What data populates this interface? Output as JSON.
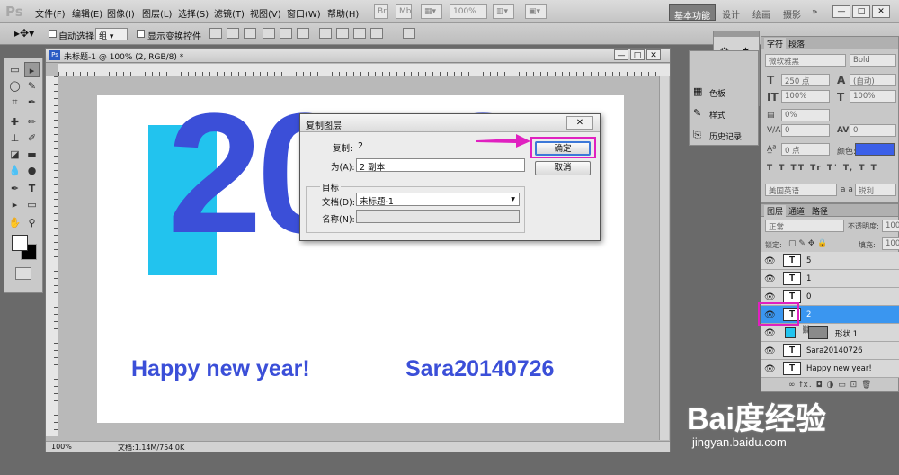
{
  "app": {
    "logo": "Ps"
  },
  "menu": [
    "文件(F)",
    "编辑(E)",
    "图像(I)",
    "图层(L)",
    "选择(S)",
    "滤镜(T)",
    "视图(V)",
    "窗口(W)",
    "帮助(H)"
  ],
  "menubar": {
    "zoom": "100%",
    "workspaces": [
      "基本功能",
      "设计",
      "绘画",
      "摄影"
    ],
    "more": "»",
    "window_buttons": [
      "—",
      "□",
      "✕"
    ]
  },
  "options": {
    "auto_select_label": "自动选择:",
    "auto_select_value": "组",
    "show_transform_label": "显示变换控件"
  },
  "document": {
    "tab_title": "未标题-1 @ 100% (2, RGB/8) *",
    "canvas_big_number": "2013",
    "canvas_text_left": "Happy new year!",
    "canvas_text_right": "Sara20140726",
    "zoom": "100%",
    "doc_size": "文档:1.14M/754.0K"
  },
  "dialog": {
    "title": "复制图层",
    "copy_label": "复制:",
    "copy_value": "2",
    "as_label": "为(A):",
    "as_value": "2 副本",
    "dest_group": "目标",
    "doc_label": "文档(D):",
    "doc_value": "未标题-1",
    "name_label": "名称(N):",
    "name_value": "",
    "ok": "确定",
    "cancel": "取消"
  },
  "dock": {
    "items": [
      "色板",
      "样式",
      "历史记录"
    ]
  },
  "character": {
    "tabs": [
      "字符",
      "段落"
    ],
    "font_family": "微软雅黑",
    "font_style": "Bold",
    "size": "250 点",
    "leading": "(自动)",
    "vscale": "100%",
    "hscale": "100%",
    "tracking_pct": "0%",
    "kerning": "0",
    "tracking": "0",
    "baseline": "0 点",
    "color_label": "颜色:",
    "color": "#3b5fe8",
    "style_buttons": [
      "T",
      "T",
      "TT",
      "Tr",
      "T'",
      "T,",
      "T",
      "T"
    ],
    "language": "美国英语",
    "aa_label": "a a",
    "aa_value": "锐利"
  },
  "layers": {
    "tabs": [
      "图层",
      "通道",
      "路径"
    ],
    "blend": "正常",
    "opacity_label": "不透明度:",
    "opacity": "100%",
    "lock_label": "锁定:",
    "fill_label": "填充:",
    "fill": "100%",
    "rows": [
      {
        "thumb": "T",
        "name": "5",
        "selected": false
      },
      {
        "thumb": "T",
        "name": "1",
        "selected": false
      },
      {
        "thumb": "T",
        "name": "0",
        "selected": false
      },
      {
        "thumb": "T",
        "name": "2",
        "selected": true
      },
      {
        "thumb": "",
        "name": "形状 1",
        "selected": false
      },
      {
        "thumb": "T",
        "name": "Sara20140726",
        "selected": false
      },
      {
        "thumb": "T",
        "name": "Happy new year!",
        "selected": false
      }
    ],
    "bottom_icons": "∞ fx. ◘ ◑ ▭ ⊡ 🗑"
  },
  "watermark": {
    "brand": "Bai度经验",
    "url": "jingyan.baidu.com"
  },
  "colors": {
    "highlight": "#e020c0",
    "canvas_blue": "#3b4fd8",
    "shape_cyan": "#22c3ee",
    "layer_selected": "#3a96f0"
  }
}
